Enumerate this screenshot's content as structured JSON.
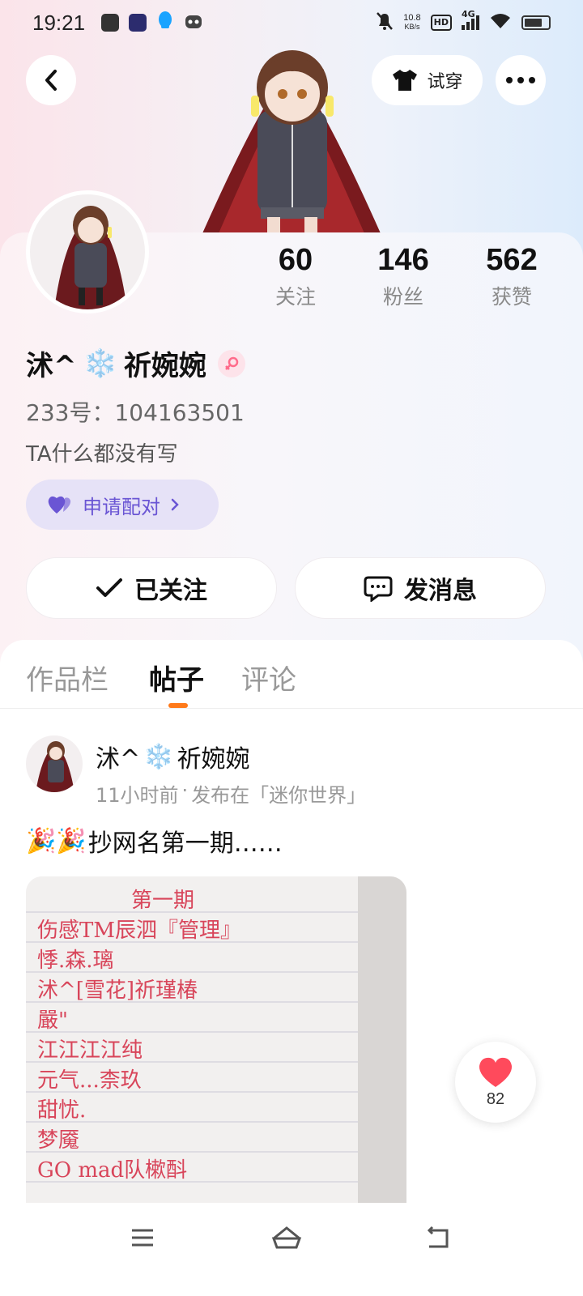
{
  "status_bar": {
    "time": "19:21",
    "net_speed_value": "10.8",
    "net_speed_unit": "KB/s",
    "hd_label": "HD",
    "network_label": "4G",
    "battery_level": 0.75
  },
  "top_nav": {
    "try_on_label": "试穿"
  },
  "profile": {
    "name_part1": "沭^",
    "name_emoji": "❄️",
    "name_part2": "祈婉婉",
    "id_text": "233号：104163501",
    "bio": "TA什么都没有写",
    "pair_label": "申请配对",
    "stats": [
      {
        "num": "60",
        "label": "关注"
      },
      {
        "num": "146",
        "label": "粉丝"
      },
      {
        "num": "562",
        "label": "获赞"
      }
    ],
    "follow_label": "已关注",
    "message_label": "发消息"
  },
  "tabs": [
    {
      "label": "作品栏"
    },
    {
      "label": "帖子"
    },
    {
      "label": "评论"
    }
  ],
  "post": {
    "author_part1": "沭^",
    "author_emoji": "❄️",
    "author_part2": "祈婉婉",
    "time": "11小时前",
    "dot": "·",
    "published_in": "发布在「迷你世界」",
    "text_emoji": "🎉🎉",
    "text": "抄网名第一期……",
    "image_lines": [
      "第一期",
      "伤感TM辰泗『管理』",
      "悸.森.璃",
      "沭^[雪花]祈瑾椿",
      "嚴\"",
      "江江江江纯",
      "元气...柰玖",
      "甜忧.",
      "梦魇",
      "GO mad队樕酙"
    ]
  },
  "like": {
    "count": "82"
  },
  "colors": {
    "accent_orange": "#ff7a1a",
    "pair_purple": "#6a55d4",
    "like_red": "#ff4a5c"
  }
}
